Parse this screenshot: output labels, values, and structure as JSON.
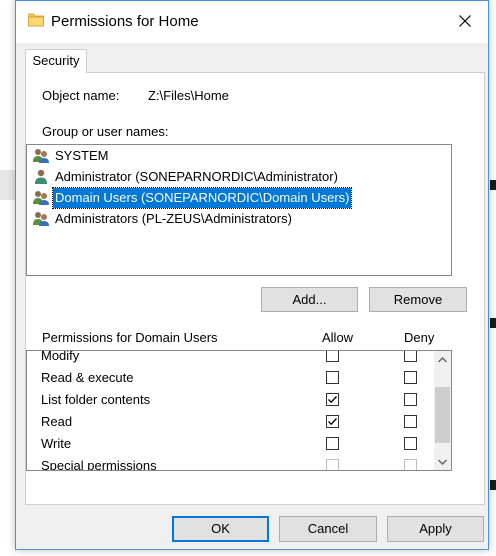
{
  "window": {
    "title": "Permissions for Home"
  },
  "tabs": [
    {
      "label": "Security"
    }
  ],
  "object": {
    "label": "Object name:",
    "value": "Z:\\Files\\Home"
  },
  "users": {
    "label": "Group or user names:",
    "items": [
      {
        "name": "SYSTEM",
        "icon": "group-icon",
        "selected": false
      },
      {
        "name": "Administrator (SONEPARNORDIC\\Administrator)",
        "icon": "user-icon",
        "selected": false
      },
      {
        "name": "Domain Users (SONEPARNORDIC\\Domain Users)",
        "icon": "group-icon",
        "selected": true
      },
      {
        "name": "Administrators (PL-ZEUS\\Administrators)",
        "icon": "group-icon",
        "selected": false
      }
    ]
  },
  "buttons": {
    "add": "Add...",
    "remove": "Remove",
    "ok": "OK",
    "cancel": "Cancel",
    "apply": "Apply"
  },
  "permissions": {
    "label": "Permissions for Domain Users",
    "allow_header": "Allow",
    "deny_header": "Deny",
    "rows": [
      {
        "name": "Modify",
        "allow": false,
        "deny": false,
        "disabled": false
      },
      {
        "name": "Read & execute",
        "allow": false,
        "deny": false,
        "disabled": false
      },
      {
        "name": "List folder contents",
        "allow": true,
        "deny": false,
        "disabled": false
      },
      {
        "name": "Read",
        "allow": true,
        "deny": false,
        "disabled": false
      },
      {
        "name": "Write",
        "allow": false,
        "deny": false,
        "disabled": false
      },
      {
        "name": "Special permissions",
        "allow": false,
        "deny": false,
        "disabled": true
      }
    ]
  },
  "colors": {
    "accent": "#0078d7",
    "window_border": "#4a90d9",
    "dialog_bg": "#f0f0f0"
  }
}
